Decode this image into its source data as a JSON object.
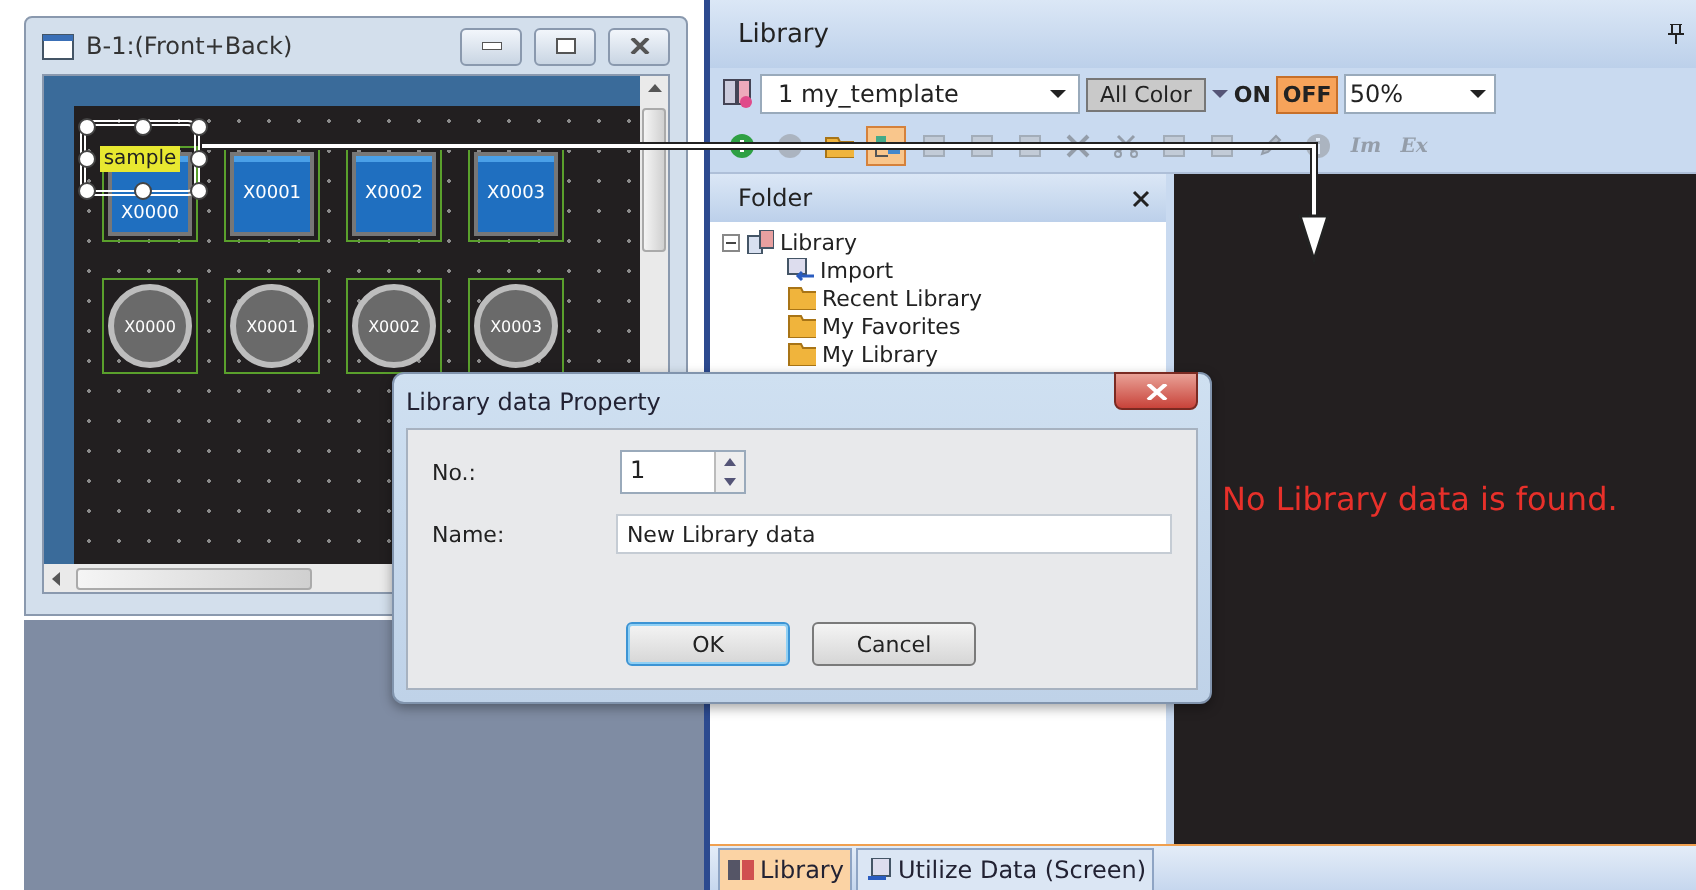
{
  "editor_window": {
    "title": "B-1:(Front+Back)",
    "sample_label": "sample",
    "rows": [
      {
        "kind": "square",
        "items": [
          "X0000",
          "X0001",
          "X0002",
          "X0003"
        ]
      },
      {
        "kind": "round",
        "items": [
          "X0000",
          "X0001",
          "X0002",
          "X0003"
        ]
      }
    ]
  },
  "library_panel": {
    "title": "Library",
    "template": "1 my_template",
    "color_mode": "All Color",
    "on_label": "ON",
    "off_label": "OFF",
    "off_selected": true,
    "zoom": "50%",
    "toolbar": [
      {
        "kind": "add",
        "disabled": false,
        "selected": false
      },
      {
        "kind": "remove",
        "disabled": true,
        "selected": false
      },
      {
        "kind": "folder",
        "disabled": false,
        "selected": false
      },
      {
        "kind": "layout",
        "disabled": false,
        "selected": true
      },
      {
        "kind": "doc",
        "disabled": true,
        "selected": false
      },
      {
        "kind": "doc",
        "disabled": true,
        "selected": false
      },
      {
        "kind": "doc",
        "disabled": true,
        "selected": false
      },
      {
        "kind": "delete",
        "disabled": true,
        "selected": false
      },
      {
        "kind": "cut",
        "disabled": true,
        "selected": false
      },
      {
        "kind": "doc",
        "disabled": true,
        "selected": false
      },
      {
        "kind": "doc",
        "disabled": true,
        "selected": false
      },
      {
        "kind": "edit",
        "disabled": true,
        "selected": false
      },
      {
        "kind": "info",
        "disabled": true,
        "selected": false
      },
      {
        "kind": "text",
        "label": "Im",
        "disabled": true,
        "selected": false
      },
      {
        "kind": "text",
        "label": "Ex",
        "disabled": true,
        "selected": false
      }
    ],
    "folder": {
      "title": "Folder",
      "tree": [
        {
          "label": "Library",
          "kind": "library",
          "expanded": true,
          "children": [
            {
              "label": "Import",
              "kind": "import"
            },
            {
              "label": "Recent Library",
              "kind": "folder"
            },
            {
              "label": "My Favorites",
              "kind": "folder"
            },
            {
              "label": "My Library",
              "kind": "folder"
            }
          ]
        }
      ]
    },
    "message": "No Library data is found.",
    "tabs": [
      {
        "label": "Library",
        "kind": "library",
        "selected": true
      },
      {
        "label": "Utilize Data (Screen)",
        "kind": "utilize",
        "selected": false
      }
    ]
  },
  "dialog": {
    "title": "Library data Property",
    "fields": [
      {
        "kind": "spinner",
        "label": "No.:",
        "value": "1"
      },
      {
        "kind": "text",
        "label": "Name:",
        "value": "New Library data"
      }
    ],
    "buttons": [
      {
        "label": "OK",
        "default": true
      },
      {
        "label": "Cancel",
        "default": false
      }
    ]
  }
}
